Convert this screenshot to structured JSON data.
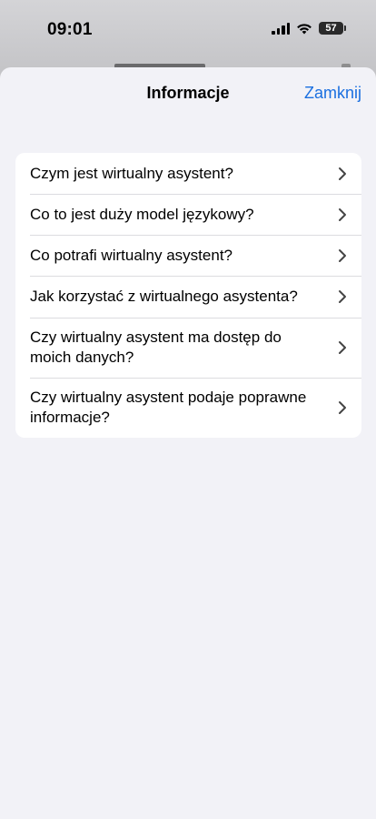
{
  "status_bar": {
    "time": "09:01",
    "battery": "57",
    "icons": [
      "signal-icon",
      "wifi-icon",
      "battery-icon"
    ]
  },
  "sheet": {
    "title": "Informacje",
    "close_label": "Zamknij"
  },
  "faq": {
    "items": [
      {
        "label": "Czym jest wirtualny asystent?"
      },
      {
        "label": "Co to jest duży model językowy?"
      },
      {
        "label": "Co potrafi wirtualny asystent?"
      },
      {
        "label": "Jak korzystać z wirtualnego asystenta?"
      },
      {
        "label": "Czy wirtualny asystent ma dostęp do moich danych?"
      },
      {
        "label": "Czy wirtualny asystent podaje poprawne informacje?"
      }
    ]
  },
  "colors": {
    "accent": "#1a6fe0",
    "sheet_background": "#f2f2f7",
    "list_background": "#ffffff"
  }
}
